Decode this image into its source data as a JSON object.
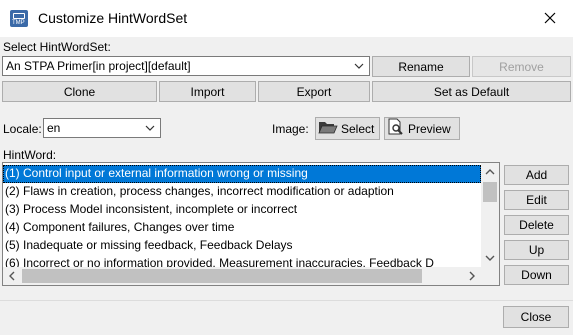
{
  "window": {
    "title": "Customize HintWordSet",
    "icon_text": "TMP"
  },
  "hintwordset": {
    "label": "Select HintWordSet:",
    "selected": "An STPA Primer[in project][default]",
    "buttons": {
      "rename": "Rename",
      "remove": "Remove",
      "clone": "Clone",
      "import": "Import",
      "export": "Export",
      "set_default": "Set as Default"
    }
  },
  "locale": {
    "label": "Locale:",
    "value": "en"
  },
  "image": {
    "label": "Image:",
    "select": "Select",
    "preview": "Preview"
  },
  "hintword": {
    "label": "HintWord:",
    "items": [
      "(1) Control input or external information wrong or missing",
      "(2) Flaws in creation, process changes, incorrect modification or adaption",
      "(3) Process Model inconsistent, incomplete or incorrect",
      "(4) Component failures, Changes over time",
      "(5) Inadequate or missing feedback, Feedback Delays",
      "(6) Incorrect or no information provided, Measurement inaccuracies, Feedback D"
    ],
    "selected_index": 0,
    "buttons": {
      "add": "Add",
      "edit": "Edit",
      "delete": "Delete",
      "up": "Up",
      "down": "Down"
    }
  },
  "footer": {
    "close": "Close"
  },
  "colors": {
    "selection": "#0078d7",
    "dialog_bg": "#f0f0f0"
  },
  "icons": [
    "app-icon",
    "close-icon",
    "chevron-down-icon",
    "folder-open-icon",
    "preview-icon",
    "scroll-up-icon",
    "scroll-down-icon",
    "scroll-left-icon",
    "scroll-right-icon"
  ]
}
